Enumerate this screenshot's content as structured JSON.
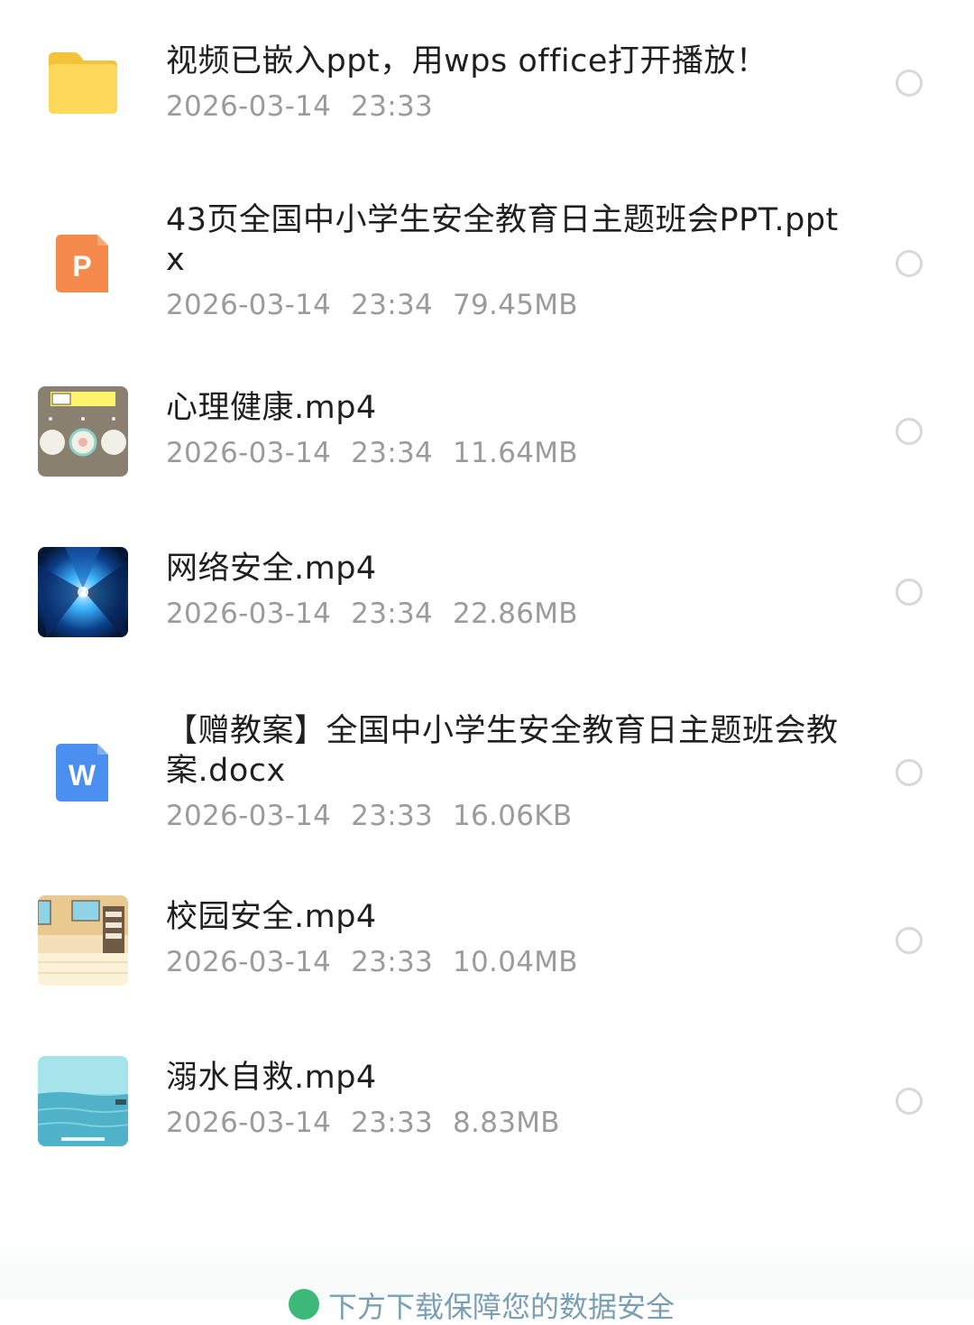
{
  "files": [
    {
      "icon": "folder-icon",
      "name": "视频已嵌入ppt，用wps office打开播放！",
      "date": "2026-03-14",
      "time": "23:33",
      "size": ""
    },
    {
      "icon": "wps-presentation-icon",
      "name": "43页全国中小学生安全教育日主题班会PPT.pptx",
      "date": "2026-03-14",
      "time": "23:34",
      "size": "79.45MB"
    },
    {
      "icon": "video-thumbnail-icon",
      "name": "心理健康.mp4",
      "date": "2026-03-14",
      "time": "23:34",
      "size": "11.64MB"
    },
    {
      "icon": "video-thumbnail-icon",
      "name": "网络安全.mp4",
      "date": "2026-03-14",
      "time": "23:34",
      "size": "22.86MB"
    },
    {
      "icon": "wps-writer-icon",
      "name": "【赠教案】全国中小学生安全教育日主题班会教案.docx",
      "date": "2026-03-14",
      "time": "23:33",
      "size": "16.06KB"
    },
    {
      "icon": "video-thumbnail-icon",
      "name": "校园安全.mp4",
      "date": "2026-03-14",
      "time": "23:33",
      "size": "10.04MB"
    },
    {
      "icon": "video-thumbnail-icon",
      "name": "溺水自救.mp4",
      "date": "2026-03-14",
      "time": "23:33",
      "size": "8.83MB"
    }
  ],
  "bottom_banner": {
    "text": "下方下载保障您的数据安全"
  },
  "colors": {
    "folder": "#fbd14b",
    "presentation": "#f6894a",
    "writer": "#4a8ef0",
    "radio_border": "#d8d8d8",
    "meta_text": "#9b9b9b"
  }
}
